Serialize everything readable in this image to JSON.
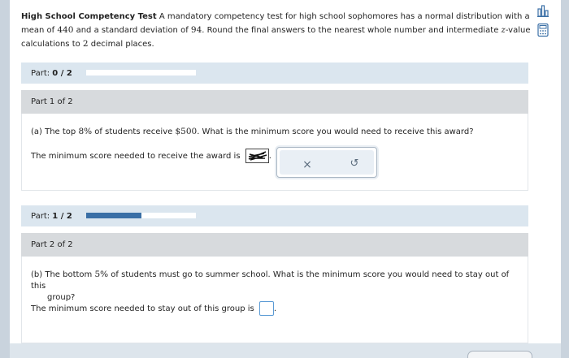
{
  "problem": {
    "title": "High School Competency Test",
    "text_1": " A mandatory competency test for high school sophomores has a normal distribution with a mean of ",
    "mean": "440",
    "text_2": " and a standard deviation of ",
    "sd": "94",
    "text_3": ". Round the final answers to the nearest whole number and intermediate ",
    "z": "z",
    "text_4": "-value calculations to ",
    "places": "2",
    "text_5": " decimal places."
  },
  "tools": {
    "chart_icon": "bar-chart-icon",
    "calculator_icon": "calculator-icon"
  },
  "part_header_1": {
    "label": "Part: ",
    "value": "0 / 2",
    "progress_fraction": 0.0
  },
  "part1": {
    "sub_label": "Part 1 of 2",
    "q_prefix": "(a) The top ",
    "q_pct": "8%",
    "q_mid": " of students receive ",
    "q_amount": "$500",
    "q_suffix": ". What is the minimum score you would need to receive this award?",
    "answer_label": "The minimum score needed to receive the award is",
    "answer_period": ".",
    "clear_symbol": "×",
    "undo_symbol": "↺"
  },
  "part_header_2": {
    "label": "Part: ",
    "value": "1 / 2",
    "progress_fraction": 0.5
  },
  "part2": {
    "sub_label": "Part 2 of 2",
    "q_prefix": "(b) The bottom ",
    "q_pct": "5%",
    "q_suffix_1": " of students must go to summer school. What is the minimum score you would need to stay out of this",
    "q_suffix_2": "group?",
    "answer_label": "The minimum score needed to stay out of this group is",
    "answer_period": "."
  },
  "colors": {
    "accent": "#3a6fa6",
    "header_bg": "#dbe6ef",
    "subheader_bg": "#d7dadd",
    "input_border": "#5b9bd5"
  }
}
